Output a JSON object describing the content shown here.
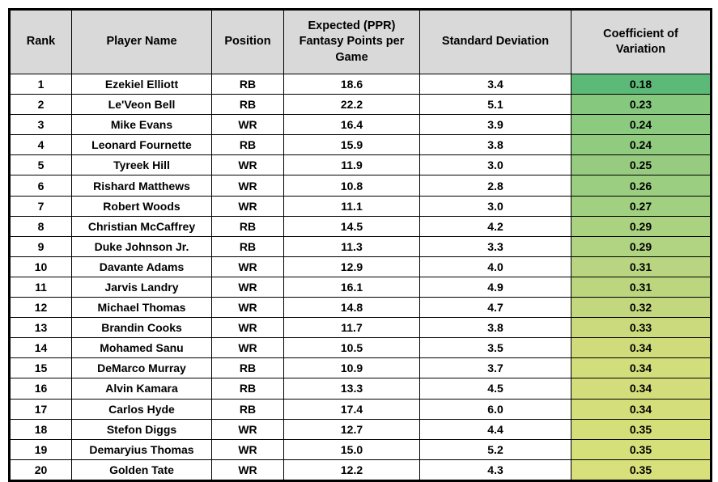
{
  "table": {
    "columns": [
      {
        "key": "rank",
        "label_lines": [
          "Rank"
        ]
      },
      {
        "key": "name",
        "label_lines": [
          "Player Name"
        ]
      },
      {
        "key": "position",
        "label_lines": [
          "Position"
        ]
      },
      {
        "key": "expected",
        "label_lines": [
          "Expected (PPR)",
          "Fantasy Points per",
          "Game"
        ]
      },
      {
        "key": "stdev",
        "label_lines": [
          "Standard Deviation"
        ]
      },
      {
        "key": "cv",
        "label_lines": [
          "Coefficient of",
          "Variation"
        ]
      }
    ],
    "header_background": "#d9d9d9",
    "border_color": "#000000",
    "rows": [
      {
        "rank": "1",
        "name": "Ezekiel Elliott",
        "position": "RB",
        "expected": "18.6",
        "stdev": "3.4",
        "cv": "0.18",
        "cv_color": "#5cb978"
      },
      {
        "rank": "2",
        "name": "Le'Veon Bell",
        "position": "RB",
        "expected": "22.2",
        "stdev": "5.1",
        "cv": "0.23",
        "cv_color": "#87c87f"
      },
      {
        "rank": "3",
        "name": "Mike Evans",
        "position": "WR",
        "expected": "16.4",
        "stdev": "3.9",
        "cv": "0.24",
        "cv_color": "#8cca80"
      },
      {
        "rank": "4",
        "name": "Leonard Fournette",
        "position": "RB",
        "expected": "15.9",
        "stdev": "3.8",
        "cv": "0.24",
        "cv_color": "#90cb80"
      },
      {
        "rank": "5",
        "name": "Tyreek Hill",
        "position": "WR",
        "expected": "11.9",
        "stdev": "3.0",
        "cv": "0.25",
        "cv_color": "#97cc80"
      },
      {
        "rank": "6",
        "name": "Rishard Matthews",
        "position": "WR",
        "expected": "10.8",
        "stdev": "2.8",
        "cv": "0.26",
        "cv_color": "#9bce80"
      },
      {
        "rank": "7",
        "name": "Robert Woods",
        "position": "WR",
        "expected": "11.1",
        "stdev": "3.0",
        "cv": "0.27",
        "cv_color": "#a2d081"
      },
      {
        "rank": "8",
        "name": "Christian McCaffrey",
        "position": "RB",
        "expected": "14.5",
        "stdev": "4.2",
        "cv": "0.29",
        "cv_color": "#aad281"
      },
      {
        "rank": "9",
        "name": "Duke Johnson Jr.",
        "position": "RB",
        "expected": "11.3",
        "stdev": "3.3",
        "cv": "0.29",
        "cv_color": "#b0d481"
      },
      {
        "rank": "10",
        "name": "Davante Adams",
        "position": "WR",
        "expected": "12.9",
        "stdev": "4.0",
        "cv": "0.31",
        "cv_color": "#bad581"
      },
      {
        "rank": "11",
        "name": "Jarvis Landry",
        "position": "WR",
        "expected": "16.1",
        "stdev": "4.9",
        "cv": "0.31",
        "cv_color": "#bcd67f"
      },
      {
        "rank": "12",
        "name": "Michael Thomas",
        "position": "WR",
        "expected": "14.8",
        "stdev": "4.7",
        "cv": "0.32",
        "cv_color": "#c3d87e"
      },
      {
        "rank": "13",
        "name": "Brandin Cooks",
        "position": "WR",
        "expected": "11.7",
        "stdev": "3.8",
        "cv": "0.33",
        "cv_color": "#cbda7d"
      },
      {
        "rank": "14",
        "name": "Mohamed Sanu",
        "position": "WR",
        "expected": "10.5",
        "stdev": "3.5",
        "cv": "0.34",
        "cv_color": "#d0dc7c"
      },
      {
        "rank": "15",
        "name": "DeMarco Murray",
        "position": "RB",
        "expected": "10.9",
        "stdev": "3.7",
        "cv": "0.34",
        "cv_color": "#d2dd7c"
      },
      {
        "rank": "16",
        "name": "Alvin Kamara",
        "position": "RB",
        "expected": "13.3",
        "stdev": "4.5",
        "cv": "0.34",
        "cv_color": "#d3dd7b"
      },
      {
        "rank": "17",
        "name": "Carlos Hyde",
        "position": "RB",
        "expected": "17.4",
        "stdev": "6.0",
        "cv": "0.34",
        "cv_color": "#d4de7b"
      },
      {
        "rank": "18",
        "name": "Stefon Diggs",
        "position": "WR",
        "expected": "12.7",
        "stdev": "4.4",
        "cv": "0.35",
        "cv_color": "#d5df7a"
      },
      {
        "rank": "19",
        "name": "Demaryius Thomas",
        "position": "WR",
        "expected": "15.0",
        "stdev": "5.2",
        "cv": "0.35",
        "cv_color": "#d6e07a"
      },
      {
        "rank": "20",
        "name": "Golden Tate",
        "position": "WR",
        "expected": "12.2",
        "stdev": "4.3",
        "cv": "0.35",
        "cv_color": "#d7e07a"
      }
    ]
  }
}
